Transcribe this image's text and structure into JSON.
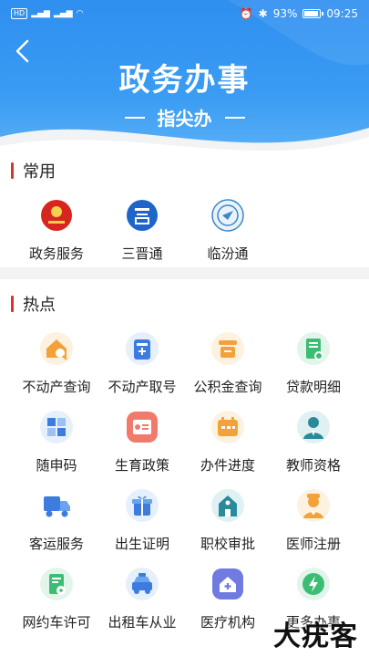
{
  "status_bar": {
    "left": "HD  4G  4G",
    "battery": "93%",
    "time": "09:25"
  },
  "header": {
    "title": "政务办事",
    "subtitle": "指尖办"
  },
  "sections": {
    "common": {
      "title": "常用",
      "items": [
        {
          "label": "政务服务",
          "icon": "government-emblem-icon"
        },
        {
          "label": "三晋通",
          "icon": "sanjintong-logo-icon"
        },
        {
          "label": "临汾通",
          "icon": "linfentong-logo-icon"
        }
      ]
    },
    "hot": {
      "title": "热点",
      "items": [
        {
          "label": "不动产查询",
          "icon": "house-search-icon"
        },
        {
          "label": "不动产取号",
          "icon": "ticket-icon"
        },
        {
          "label": "公积金查询",
          "icon": "fund-icon"
        },
        {
          "label": "贷款明细",
          "icon": "loan-doc-icon"
        },
        {
          "label": "随申码",
          "icon": "qr-code-icon"
        },
        {
          "label": "生育政策",
          "icon": "certificate-icon"
        },
        {
          "label": "办件进度",
          "icon": "calendar-icon"
        },
        {
          "label": "教师资格",
          "icon": "teacher-icon"
        },
        {
          "label": "客运服务",
          "icon": "truck-icon"
        },
        {
          "label": "出生证明",
          "icon": "gift-icon"
        },
        {
          "label": "职校审批",
          "icon": "school-icon"
        },
        {
          "label": "医师注册",
          "icon": "doctor-icon"
        },
        {
          "label": "网约车许可",
          "icon": "permit-doc-icon"
        },
        {
          "label": "出租车从业",
          "icon": "taxi-icon"
        },
        {
          "label": "医疗机构",
          "icon": "hospital-icon"
        },
        {
          "label": "更多办事",
          "icon": "lightning-icon"
        }
      ]
    }
  },
  "watermark": "大疣客",
  "colors": {
    "primary_blue": "#2f8ff0",
    "section_bar": "#d9342b"
  }
}
